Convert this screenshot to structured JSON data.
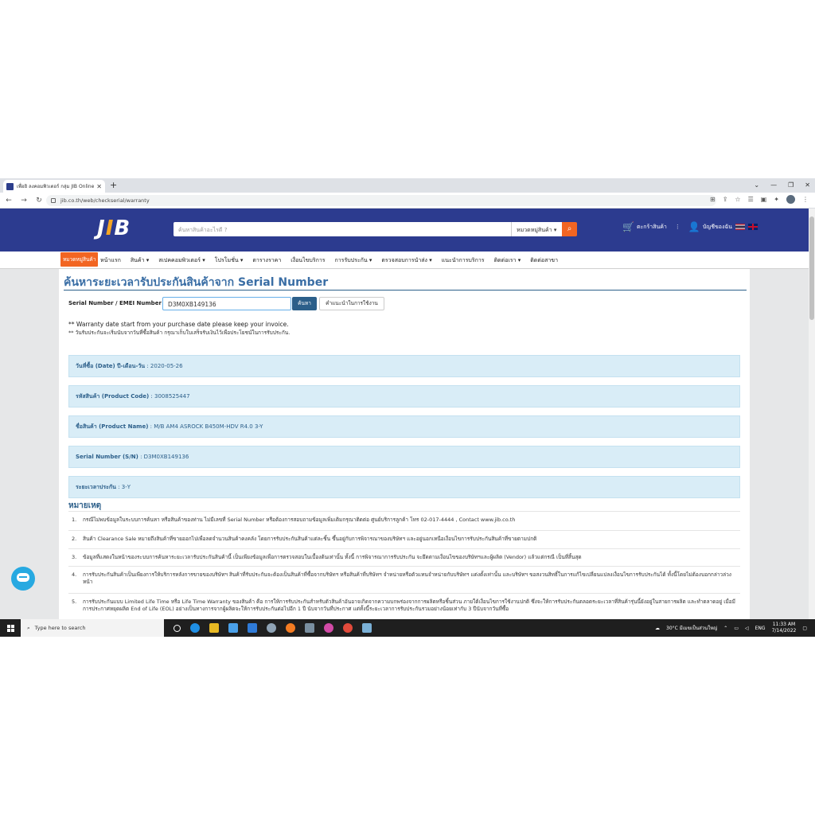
{
  "browser": {
    "tab_title": "เพื่อยิ ลงคอมพิวเตอร์ กลุ่ม JIB Online",
    "tab_close": "✕",
    "new_tab": "+",
    "url": "jib.co.th/web/checkserial/warranty"
  },
  "site": {
    "logo_text_a": "J",
    "logo_text_b": "I",
    "logo_text_c": "B",
    "search_placeholder": "ค้นหาสินค้าอะไรดี ?",
    "category_select": "หมวดหมู่สินค้า ▾",
    "cart_label": "ตะกร้าสินค้า",
    "account_label": "บัญชีของฉัน"
  },
  "nav": {
    "category_button": "หมวดหมู่สินค้า",
    "items": [
      "หน้าแรก",
      "สินค้า ▾",
      "สเปคคอมพิวเตอร์ ▾",
      "โปรโมชั่น ▾",
      "ตารางราคา",
      "เงื่อนไขบริการ",
      "การรับประกัน ▾",
      "ตรวจสอบการนำส่ง ▾",
      "แนะนำการบริการ",
      "ติดต่อเรา ▾",
      "ติดต่อสาขา"
    ]
  },
  "page": {
    "title": "ค้นหาระยะเวลารับประกันสินค้าจาก Serial Number",
    "sn_label": "Serial Number / EMEI Number :",
    "sn_value": "D3M0XB149136",
    "find_button": "ค้นหา",
    "help_button": "คำแนะนำในการใช้งาน",
    "note_en": "** Warranty date start from your purchase date please keep your invoice.",
    "note_th": "** วันรับประกันจะเริ่มนับจากวันที่ซื้อสินค้า กรุณาเก็บใบเสร็จรับเงินไว้เพื่อประโยชน์ในการรับประกัน."
  },
  "results": [
    {
      "label": "วันที่ซื้อ (Date) ปี-เดือน-วัน",
      "value": "2020-05-26"
    },
    {
      "label": "รหัสสินค้า (Product Code)",
      "value": "3008525447"
    },
    {
      "label": "ชื่อสินค้า (Product Name)",
      "value": "M/B AM4 ASROCK B450M-HDV R4.0 3-Y"
    },
    {
      "label": "Serial Number (S/N)",
      "value": "D3M0XB149136"
    },
    {
      "label": "ระยะเวลาประกัน",
      "value": "3-Y"
    }
  ],
  "remarks": {
    "heading": "หมายเหตุ",
    "items": [
      {
        "n": "1.",
        "text": "กรณีไม่พบข้อมูลในระบบการค้นหา หรือสินค้าของท่าน ไม่มีเลขที่ Serial Number หรือต้องการสอบถามข้อมูลเพิ่มเติมกรุณาติดต่อ ศูนย์บริการลูกค้า โทร 02-017-4444 , Contact www.jib.co.th"
      },
      {
        "n": "2.",
        "text": "สินค้า Clearance Sale หมายถึงสินค้าที่ขายออกไปเพื่อลดจำนวนสินค้าคงคลัง โดยการรับประกันสินค้าแต่ละชิ้น ขึ้นอยู่กับการพิจารณาของบริษัทฯ และอยู่นอกเหนือเงื่อนไขการรับประกันสินค้าที่ขายตามปกติ"
      },
      {
        "n": "3.",
        "text": "ข้อมูลที่แสดงในหน้าของระบบการค้นหาระยะเวลารับประกันสินค้านี้ เป็นเพียงข้อมูลเพื่อการตรวจสอบในเบื้องต้นเท่านั้น ทั้งนี้ การพิจารณาการรับประกัน จะยึดตามเงื่อนไขของบริษัทฯและผู้ผลิต (Vendor) แล้วแต่กรณี เป็นที่สิ้นสุด"
      },
      {
        "n": "4.",
        "text": "การรับประกันสินค้าเป็นเพียงการให้บริการหลังการขายของบริษัทฯ สินค้าที่รับประกันจะต้องเป็นสินค้าที่ซื้อจากบริษัทฯ หรือสินค้าที่บริษัทฯ จำหน่ายหรือตัวแทนจำหน่ายกับบริษัทฯ แต่งตั้งเท่านั้น และบริษัทฯ ขอสงวนสิทธิ์ในการแก้ไขเปลี่ยนแปลงเงื่อนไขการรับประกันได้ ทั้งนี้โดยไม่ต้องบอกกล่าวล่วงหน้า"
      },
      {
        "n": "5.",
        "text": "การรับประกันแบบ Limited Life Time หรือ Life Time Warranty ของสินค้า คือ การให้การรับประกันสำหรับตัวสินค้าอันอาจเกิดจากความบกพร่องจากการผลิตหรือชิ้นส่วน ภายใต้เงื่อนไขการใช้งานปกติ ซึ่งจะให้การรับประกันตลอดระยะเวลาที่สินค้ารุ่นนี้ยังอยู่ในสายการผลิต และทำตลาดอยู่ เมื่อมีการประกาศหยุดผลิต End of Life (EOL) อย่างเป็นทางการจากผู้ผลิตจะให้การรับประกันต่อไปอีก 1 ปี นับจากวันที่ประกาศ แต่ทั้งนี้ระยะเวลาการรับประกันรวมอย่างน้อยเท่ากับ 3 ปีนับจากวันที่ซื้อ"
      }
    ]
  },
  "taskbar": {
    "search_placeholder": "Type here to search",
    "weather": "30°C มีเมฆเป็นส่วนใหญ่",
    "lang": "ENG",
    "time": "11:33 AM",
    "date": "7/14/2022"
  }
}
